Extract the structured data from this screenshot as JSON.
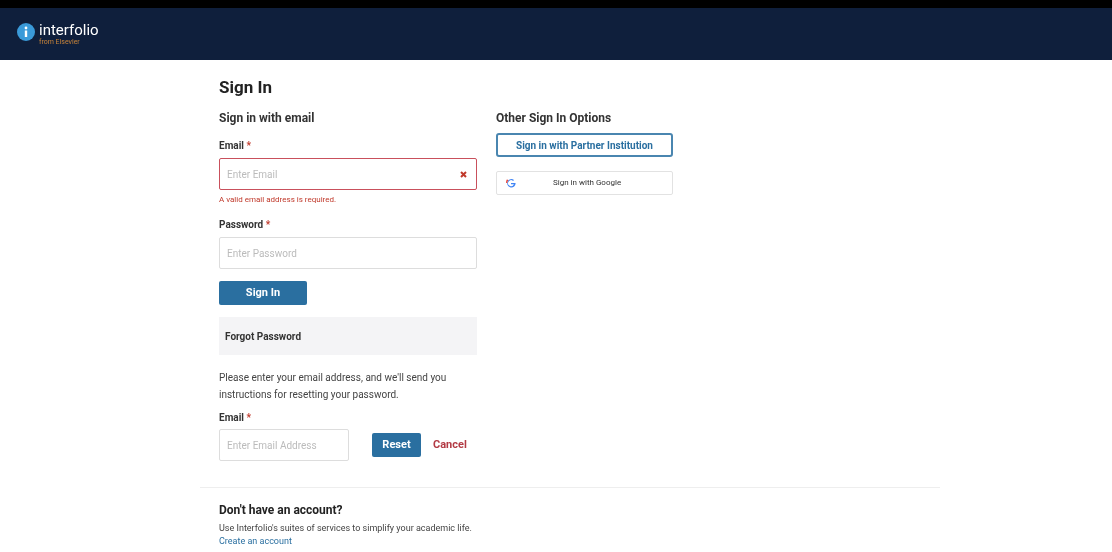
{
  "header": {
    "logo_text": "interfolio",
    "logo_subtext": "from Elsevier"
  },
  "title": "Sign In",
  "email_signin": {
    "heading": "Sign in with email",
    "fields": [
      {
        "label": "Email",
        "required_mark": "*",
        "placeholder": "Enter Email",
        "invalid": true,
        "error_message": "A valid email address is required."
      },
      {
        "label": "Password",
        "required_mark": "*",
        "placeholder": "Enter Password",
        "invalid": false
      }
    ],
    "submit": "Sign In"
  },
  "forgot_password": {
    "heading": "Forgot Password",
    "instructions": "Please enter your email address, and we'll send you instructions for resetting your password.",
    "label": "Email",
    "required_mark": "*",
    "placeholder": "Enter Email Address",
    "reset": "Reset",
    "cancel": "Cancel"
  },
  "other_options": {
    "heading": "Other Sign In Options",
    "buttons": [
      {
        "kind": "outline",
        "label": "Sign in with Partner Institution"
      },
      {
        "kind": "google",
        "label": "Sign in with Google"
      }
    ]
  },
  "signup": {
    "heading": "Don't have an account?",
    "text": "Use Interfolio's suites of services to simplify your academic life.",
    "link": "Create an account"
  }
}
